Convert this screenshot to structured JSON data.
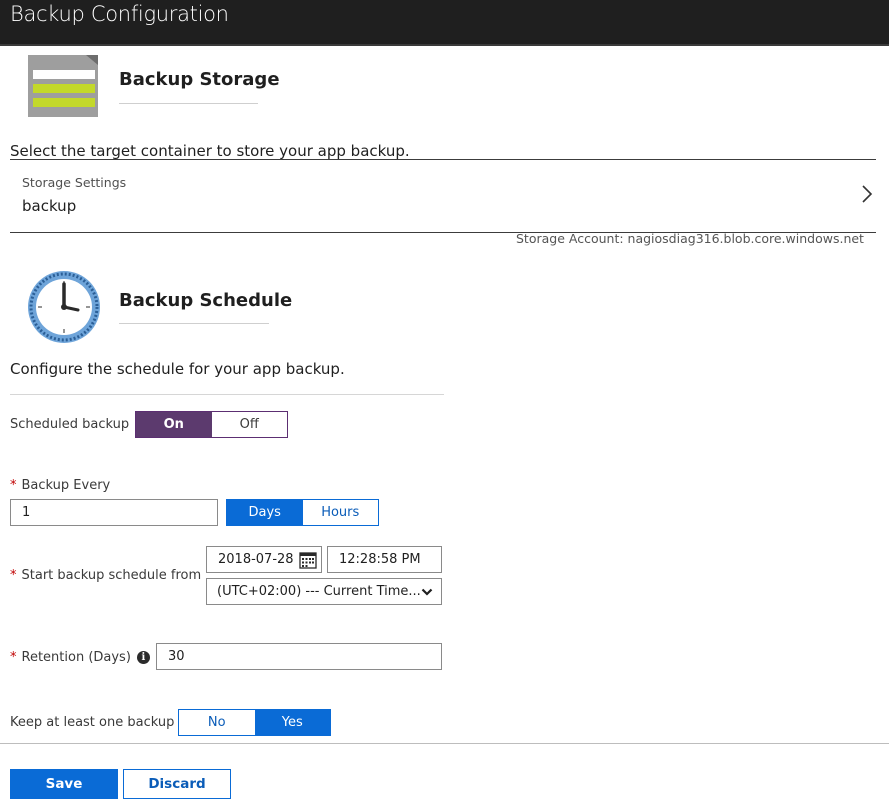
{
  "window": {
    "title": "Backup Configuration"
  },
  "storage": {
    "heading": "Backup Storage",
    "description": "Select the target container to store your app backup.",
    "settings_label": "Storage Settings",
    "settings_value": "backup",
    "account_caption": "Storage Account: nagiosdiag316.blob.core.windows.net"
  },
  "schedule": {
    "heading": "Backup Schedule",
    "description": "Configure the schedule for your app backup.",
    "scheduled_backup": {
      "label": "Scheduled backup",
      "on": "On",
      "off": "Off",
      "selected": "On"
    },
    "backup_every": {
      "required": "*",
      "label": "Backup Every",
      "value": "1",
      "days": "Days",
      "hours": "Hours",
      "selected": "Days"
    },
    "start": {
      "required": "*",
      "label": "Start backup schedule from",
      "date": "2018-07-28",
      "time": "12:28:58 PM",
      "timezone": "(UTC+02:00) --- Current Time..."
    },
    "retention": {
      "required": "*",
      "label": "Retention (Days)",
      "info": "i",
      "value": "30"
    },
    "keep_one": {
      "label": "Keep at least one backup",
      "no": "No",
      "yes": "Yes",
      "selected": "Yes"
    }
  },
  "footer": {
    "save": "Save",
    "discard": "Discard"
  },
  "colors": {
    "titlebar": "#1f1f1f",
    "accent_blue": "#0a6bd6",
    "toggle_purple": "#5c3a6e"
  }
}
